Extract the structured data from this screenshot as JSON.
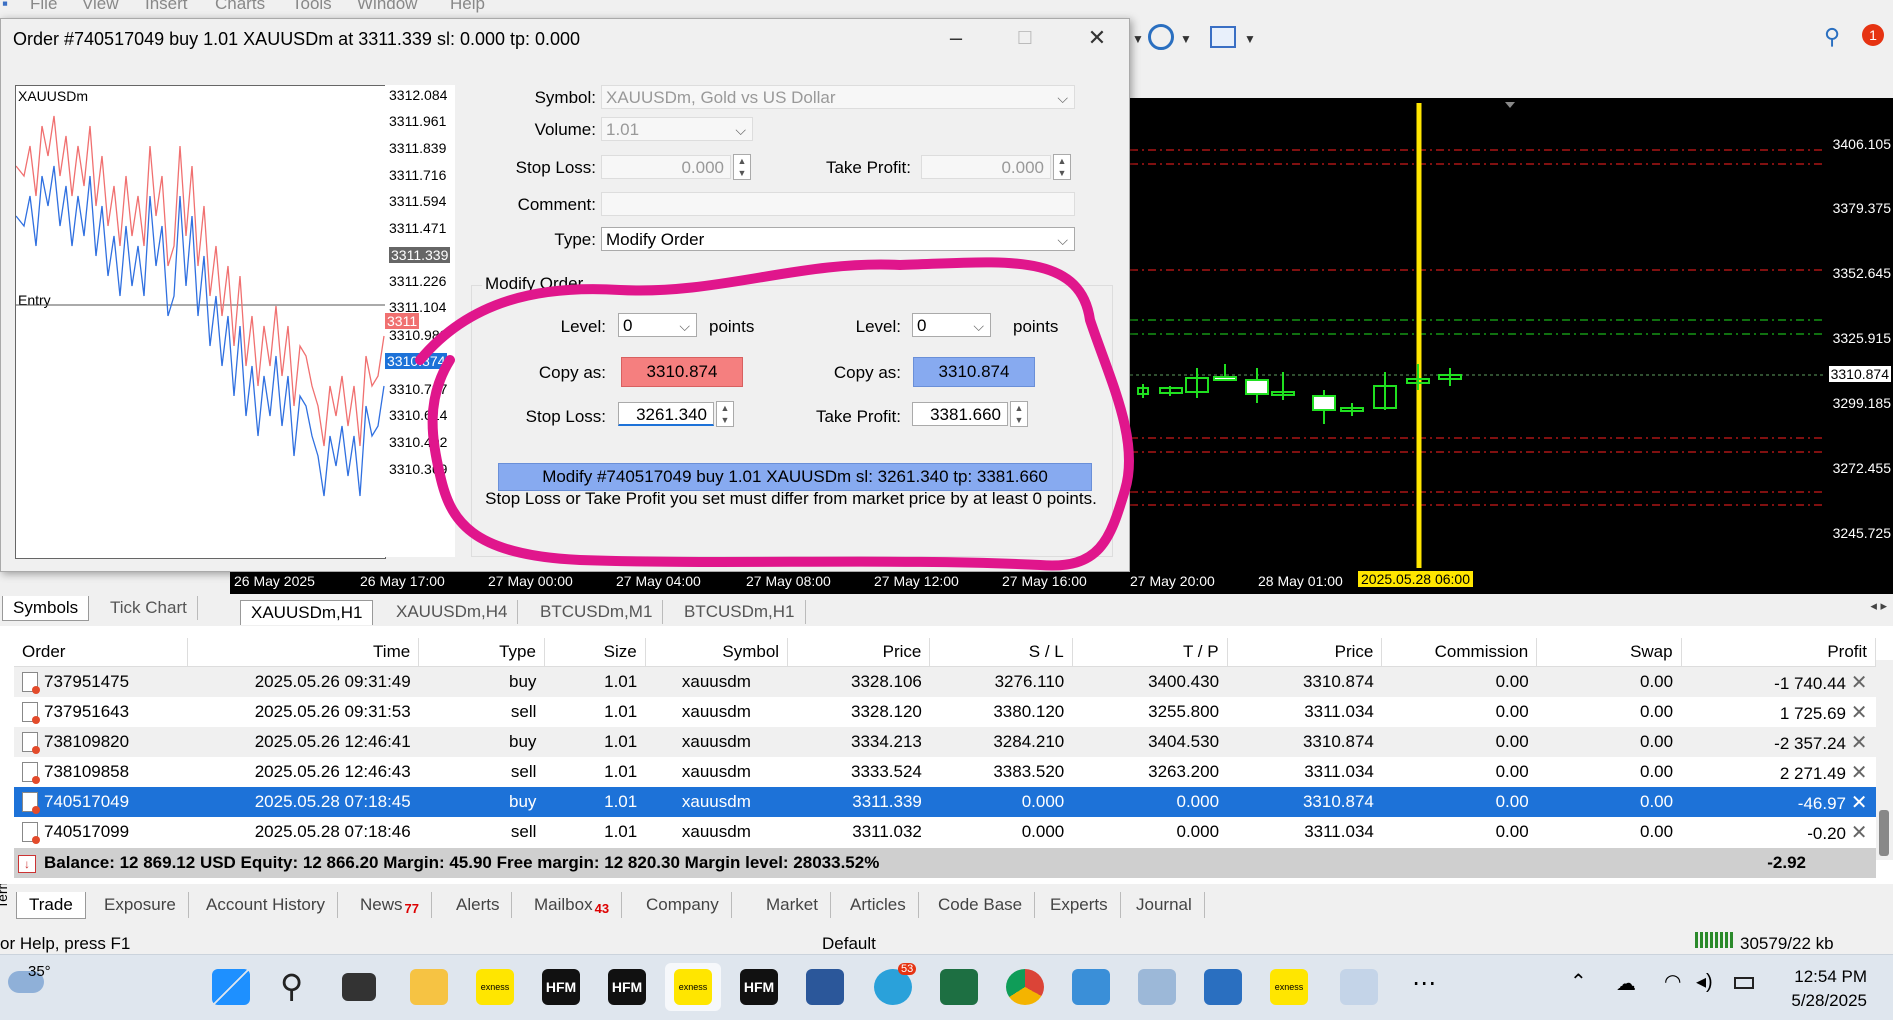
{
  "menubar": [
    "File",
    "View",
    "Insert",
    "Charts",
    "Tools",
    "Window",
    "Help"
  ],
  "dialog": {
    "title": "Order #740517049 buy 1.01 XAUUSDm at 3311.339 sl: 0.000 tp: 0.000",
    "symbol_label": "Symbol:",
    "symbol_value": "XAUUSDm, Gold vs US Dollar",
    "volume_label": "Volume:",
    "volume_value": "1.01",
    "stop_loss_label": "Stop Loss:",
    "stop_loss_value": "0.000",
    "take_profit_label": "Take Profit:",
    "take_profit_value": "0.000",
    "comment_label": "Comment:",
    "type_label": "Type:",
    "type_value": "Modify Order",
    "group_title": "Modify Order",
    "level_label": "Level:",
    "sl_level_value": "0",
    "tp_level_value": "0",
    "points_label": "points",
    "copy_as_label": "Copy as:",
    "sl_copy_value": "3310.874",
    "tp_copy_value": "3310.874",
    "modify_sl_label": "Stop Loss:",
    "modify_sl_value": "3261.340",
    "modify_tp_label": "Take Profit:",
    "modify_tp_value": "3381.660",
    "modify_button": "Modify #740517049 buy 1.01 XAUUSDm sl: 3261.340 tp: 3381.660",
    "note": "Stop Loss or Take Profit you set must differ from market price by at least 0 points.",
    "mini_chart": {
      "symbol": "XAUUSDm",
      "entry_label": "Entry",
      "ticks": [
        "3312.084",
        "3311.961",
        "3311.839",
        "3311.716",
        "3311.594",
        "3311.471",
        "3311.339",
        "3311.226",
        "3311.104",
        "3311",
        "3310.982",
        "3310.874",
        "3310.737",
        "3310.614",
        "3310.492",
        "3310.369"
      ]
    }
  },
  "chart": {
    "price_ticks": [
      "3406.105",
      "3379.375",
      "3352.645",
      "3325.915",
      "3310.874",
      "3299.185",
      "3272.455",
      "3245.725"
    ],
    "time_ticks": [
      "26 May 2025",
      "26 May 17:00",
      "27 May 00:00",
      "27 May 04:00",
      "27 May 08:00",
      "27 May 12:00",
      "27 May 16:00",
      "27 May 20:00",
      "28 May 01:00",
      "2025.05.28 06:00"
    ],
    "tabs": [
      "XAUUSDm,H1",
      "XAUUSDm,H4",
      "BTCUSDm,M1",
      "BTCUSDm,H1"
    ]
  },
  "navigator_tabs": [
    "Symbols",
    "Tick Chart"
  ],
  "terminal": {
    "columns": [
      "Order",
      "Time",
      "Type",
      "Size",
      "Symbol",
      "Price",
      "S / L",
      "T / P",
      "Price",
      "Commission",
      "Swap",
      "Profit"
    ],
    "rows": [
      {
        "order": "737951475",
        "time": "2025.05.26 09:31:49",
        "type": "buy",
        "size": "1.01",
        "symbol": "xauusdm",
        "price": "3328.106",
        "sl": "3276.110",
        "tp": "3400.430",
        "cur": "3310.874",
        "commission": "0.00",
        "swap": "0.00",
        "profit": "-1 740.44"
      },
      {
        "order": "737951643",
        "time": "2025.05.26 09:31:53",
        "type": "sell",
        "size": "1.01",
        "symbol": "xauusdm",
        "price": "3328.120",
        "sl": "3380.120",
        "tp": "3255.800",
        "cur": "3311.034",
        "commission": "0.00",
        "swap": "0.00",
        "profit": "1 725.69"
      },
      {
        "order": "738109820",
        "time": "2025.05.26 12:46:41",
        "type": "buy",
        "size": "1.01",
        "symbol": "xauusdm",
        "price": "3334.213",
        "sl": "3284.210",
        "tp": "3404.530",
        "cur": "3310.874",
        "commission": "0.00",
        "swap": "0.00",
        "profit": "-2 357.24"
      },
      {
        "order": "738109858",
        "time": "2025.05.26 12:46:43",
        "type": "sell",
        "size": "1.01",
        "symbol": "xauusdm",
        "price": "3333.524",
        "sl": "3383.520",
        "tp": "3263.200",
        "cur": "3311.034",
        "commission": "0.00",
        "swap": "0.00",
        "profit": "2 271.49"
      },
      {
        "order": "740517049",
        "time": "2025.05.28 07:18:45",
        "type": "buy",
        "size": "1.01",
        "symbol": "xauusdm",
        "price": "3311.339",
        "sl": "0.000",
        "tp": "0.000",
        "cur": "3310.874",
        "commission": "0.00",
        "swap": "0.00",
        "profit": "-46.97"
      },
      {
        "order": "740517099",
        "time": "2025.05.28 07:18:46",
        "type": "sell",
        "size": "1.01",
        "symbol": "xauusdm",
        "price": "3311.032",
        "sl": "0.000",
        "tp": "0.000",
        "cur": "3311.034",
        "commission": "0.00",
        "swap": "0.00",
        "profit": "-0.20"
      }
    ],
    "balance_text": "Balance: 12 869.12 USD  Equity: 12 866.20  Margin: 45.90  Free margin: 12 820.30  Margin level: 28033.52%",
    "balance_profit": "-2.92",
    "tabs": [
      {
        "label": "Trade",
        "badge": ""
      },
      {
        "label": "Exposure",
        "badge": ""
      },
      {
        "label": "Account History",
        "badge": ""
      },
      {
        "label": "News",
        "badge": "77"
      },
      {
        "label": "Alerts",
        "badge": ""
      },
      {
        "label": "Mailbox",
        "badge": "43"
      },
      {
        "label": "Company",
        "badge": ""
      },
      {
        "label": "Market",
        "badge": ""
      },
      {
        "label": "Articles",
        "badge": ""
      },
      {
        "label": "Code Base",
        "badge": ""
      },
      {
        "label": "Experts",
        "badge": ""
      },
      {
        "label": "Journal",
        "badge": ""
      }
    ],
    "side_label": "Terminal"
  },
  "status": {
    "help": "or Help, press F1",
    "profile": "Default",
    "traffic": "30579/22 kb"
  },
  "taskbar": {
    "weather": "35°",
    "time": "12:54 PM",
    "date": "5/28/2025",
    "telegram_badge": "53",
    "notification_badge": "1",
    "app_labels": [
      "exness",
      "HFM",
      "HFM",
      "exness",
      "HFM",
      "exness"
    ]
  },
  "colors": {
    "annotation": "#e0168c",
    "selection": "#1d72d8",
    "sl_copy": "#f57f7f",
    "tp_copy": "#87aaf0"
  }
}
